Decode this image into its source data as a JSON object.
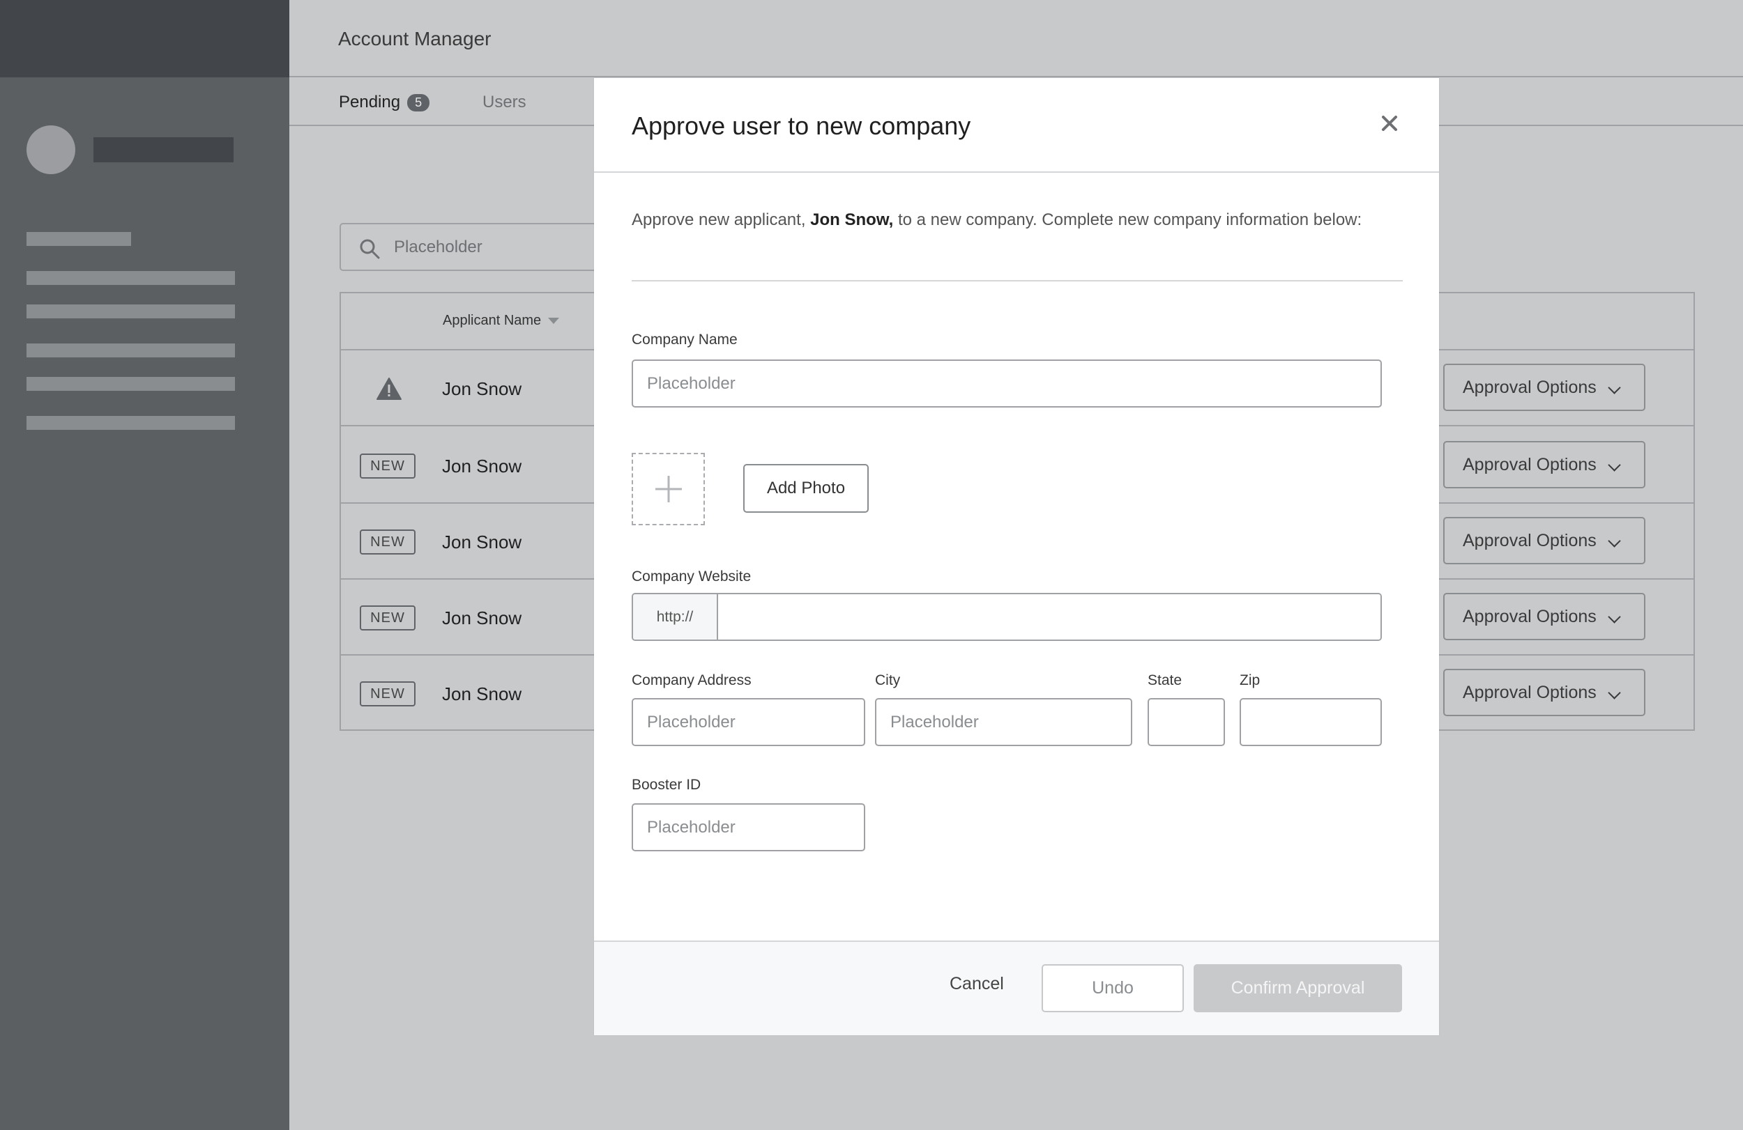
{
  "header": {
    "title": "Account Manager"
  },
  "tabs": {
    "pending": {
      "label": "Pending",
      "count": "5"
    },
    "users": {
      "label": "Users"
    }
  },
  "search": {
    "placeholder": "Placeholder"
  },
  "table": {
    "column_applicant": "Applicant Name",
    "rows": [
      {
        "tag": "warning",
        "name": "Jon Snow",
        "action": "Approval Options"
      },
      {
        "tag": "NEW",
        "name": "Jon Snow",
        "action": "Approval Options"
      },
      {
        "tag": "NEW",
        "name": "Jon Snow",
        "action": "Approval Options"
      },
      {
        "tag": "NEW",
        "name": "Jon Snow",
        "action": "Approval Options"
      },
      {
        "tag": "NEW",
        "name": "Jon Snow",
        "action": "Approval Options"
      }
    ]
  },
  "modal": {
    "title": "Approve user to new company",
    "intro_prefix": "Approve new applicant,",
    "intro_name": "Jon Snow,",
    "intro_suffix": "to a new company.  Complete new company information below:",
    "company_name": {
      "label": "Company Name",
      "placeholder": "Placeholder"
    },
    "add_photo": "Add Photo",
    "website": {
      "label": "Company Website",
      "prefix": "http://",
      "value": ""
    },
    "address": {
      "label": "Company Address",
      "placeholder": "Placeholder"
    },
    "city": {
      "label": "City",
      "placeholder": "Placeholder"
    },
    "state": {
      "label": "State",
      "value": ""
    },
    "zip": {
      "label": "Zip",
      "value": ""
    },
    "booster": {
      "label": "Booster ID",
      "placeholder": "Placeholder"
    },
    "footer": {
      "cancel": "Cancel",
      "undo": "Undo",
      "confirm": "Confirm Approval"
    }
  },
  "icons": {
    "search": "search-icon",
    "warning": "warning-icon",
    "close": "close-icon",
    "plus": "plus-icon",
    "chevron": "chevron-down-icon"
  },
  "colors": {
    "sidebar": "#5b5f62",
    "sidebar_header": "#42464a",
    "overlay_bg": "#c8c9cb",
    "modal_bg": "#ffffff",
    "confirm_disabled": "#c8c9cb"
  }
}
